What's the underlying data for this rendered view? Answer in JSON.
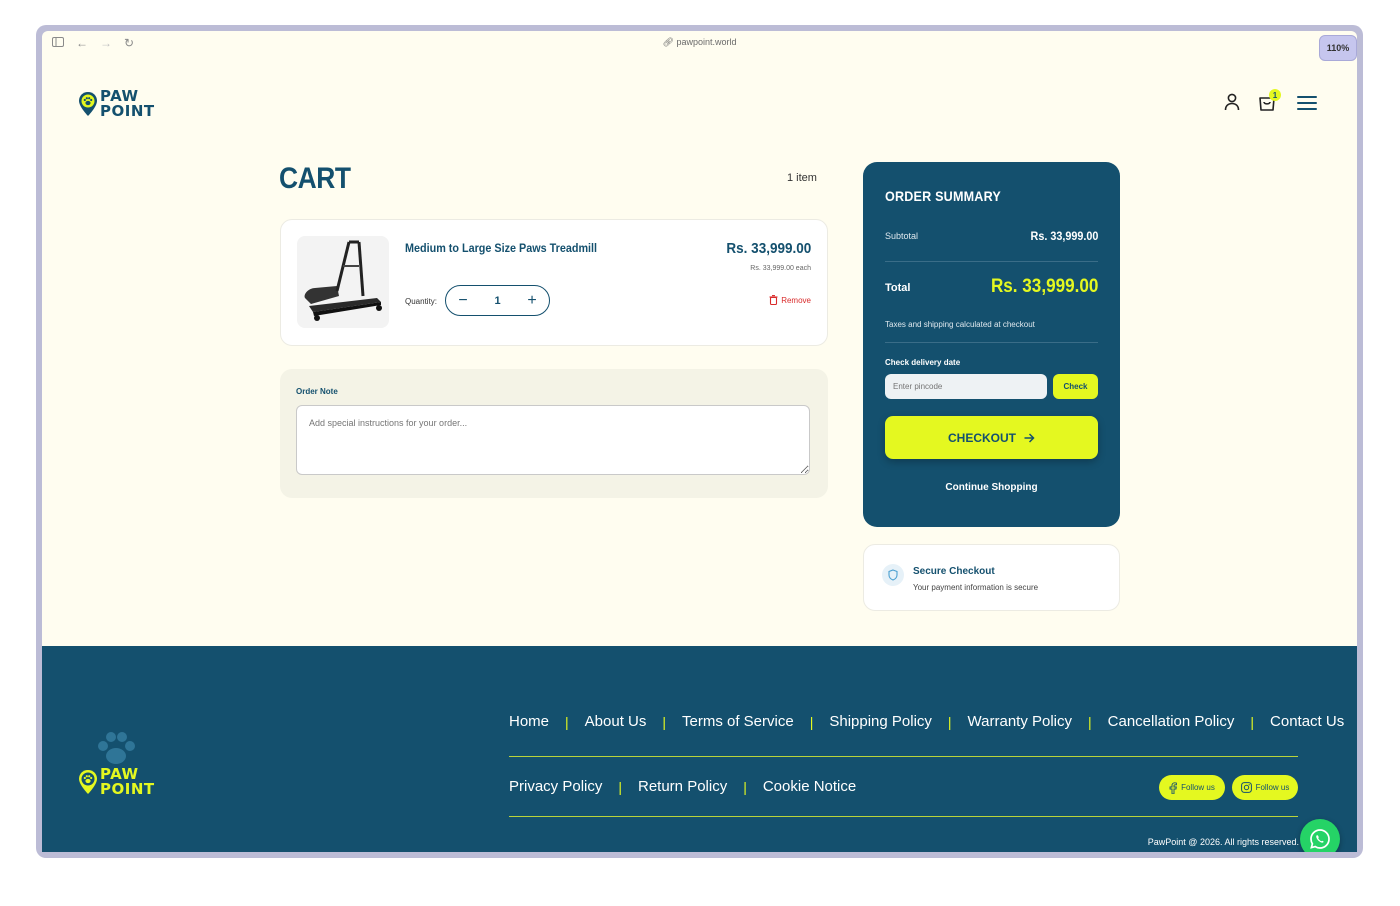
{
  "browser": {
    "url": "pawpoint.world",
    "zoom": "110%"
  },
  "logo": {
    "line1": "PAW",
    "line2": "POINT"
  },
  "header": {
    "cart_badge": "1"
  },
  "cart": {
    "title": "CART",
    "item_count": "1 item",
    "item": {
      "name": "Medium to Large Size Paws Treadmill",
      "price": "Rs. 33,999.00",
      "each": "Rs. 33,999.00 each",
      "quantity_label": "Quantity:",
      "quantity": "1",
      "remove_label": "Remove"
    },
    "note": {
      "label": "Order Note",
      "placeholder": "Add special instructions for your order..."
    }
  },
  "summary": {
    "title": "ORDER SUMMARY",
    "subtotal_label": "Subtotal",
    "subtotal_value": "Rs. 33,999.00",
    "total_label": "Total",
    "total_value": "Rs. 33,999.00",
    "taxes_note": "Taxes and shipping calculated at checkout",
    "delivery_label": "Check delivery date",
    "pincode_placeholder": "Enter pincode",
    "check_label": "Check",
    "checkout_label": "CHECKOUT",
    "continue_label": "Continue Shopping"
  },
  "secure": {
    "title": "Secure Checkout",
    "subtitle": "Your payment information is secure"
  },
  "footer": {
    "links_row1": [
      "Home",
      "About Us",
      "Terms of Service",
      "Shipping Policy",
      "Warranty Policy",
      "Cancellation Policy",
      "Contact Us"
    ],
    "links_row2": [
      "Privacy Policy",
      "Return Policy",
      "Cookie Notice"
    ],
    "follow_facebook": "Follow us",
    "follow_instagram": "Follow us",
    "copyright": "PawPoint @ 2026. All rights reserved."
  },
  "colors": {
    "brand": "#14506e",
    "accent": "#e4f820",
    "background": "#fffdf0",
    "remove": "#d92b2b",
    "whatsapp": "#25d366"
  }
}
